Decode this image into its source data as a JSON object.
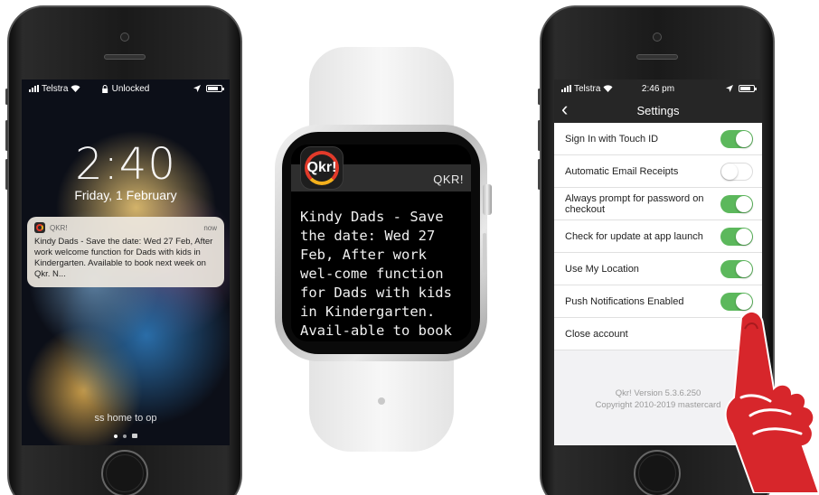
{
  "lock_phone": {
    "statusbar": {
      "carrier": "Telstra",
      "lock_status": "Unlocked"
    },
    "time": "2:40",
    "date": "Friday, 1 February",
    "notification": {
      "app": "QKR!",
      "when": "now",
      "body": "Kindy Dads - Save the date: Wed 27 Feb, After work welcome function for Dads with kids in Kindergarten. Available to book next week on Qkr. N..."
    },
    "unlock_hint": "ss home to op"
  },
  "watch": {
    "icon_text": "Qkr!",
    "app_name": "QKR!",
    "message": "Kindy Dads - Save the date: Wed 27 Feb, After work wel-come function for Dads with kids in Kindergarten. Avail-able to book next"
  },
  "settings_phone": {
    "statusbar": {
      "carrier": "Telstra",
      "time": "2:46 pm"
    },
    "title": "Settings",
    "rows": [
      {
        "label": "Sign In with Touch ID",
        "toggle": true
      },
      {
        "label": "Automatic Email Receipts",
        "toggle": false
      },
      {
        "label": "Always prompt for password on checkout",
        "toggle": true
      },
      {
        "label": "Check for update at app launch",
        "toggle": true
      },
      {
        "label": "Use My Location",
        "toggle": true
      },
      {
        "label": "Push Notifications Enabled",
        "toggle": true
      },
      {
        "label": "Close account",
        "toggle": null
      }
    ],
    "version": "Qkr! Version 5.3.6.250",
    "copyright": "Copyright 2010-2019 mastercard"
  },
  "colors": {
    "toggle_on": "#5cb85c",
    "qkr_red": "#e23a2a",
    "qkr_yellow": "#f3b01c",
    "foam_finger": "#d7262b"
  },
  "icons": [
    "signal-icon",
    "wifi-icon",
    "lock-icon",
    "location-icon",
    "battery-icon",
    "back-chevron-icon",
    "camera-icon",
    "foam-finger-icon"
  ]
}
